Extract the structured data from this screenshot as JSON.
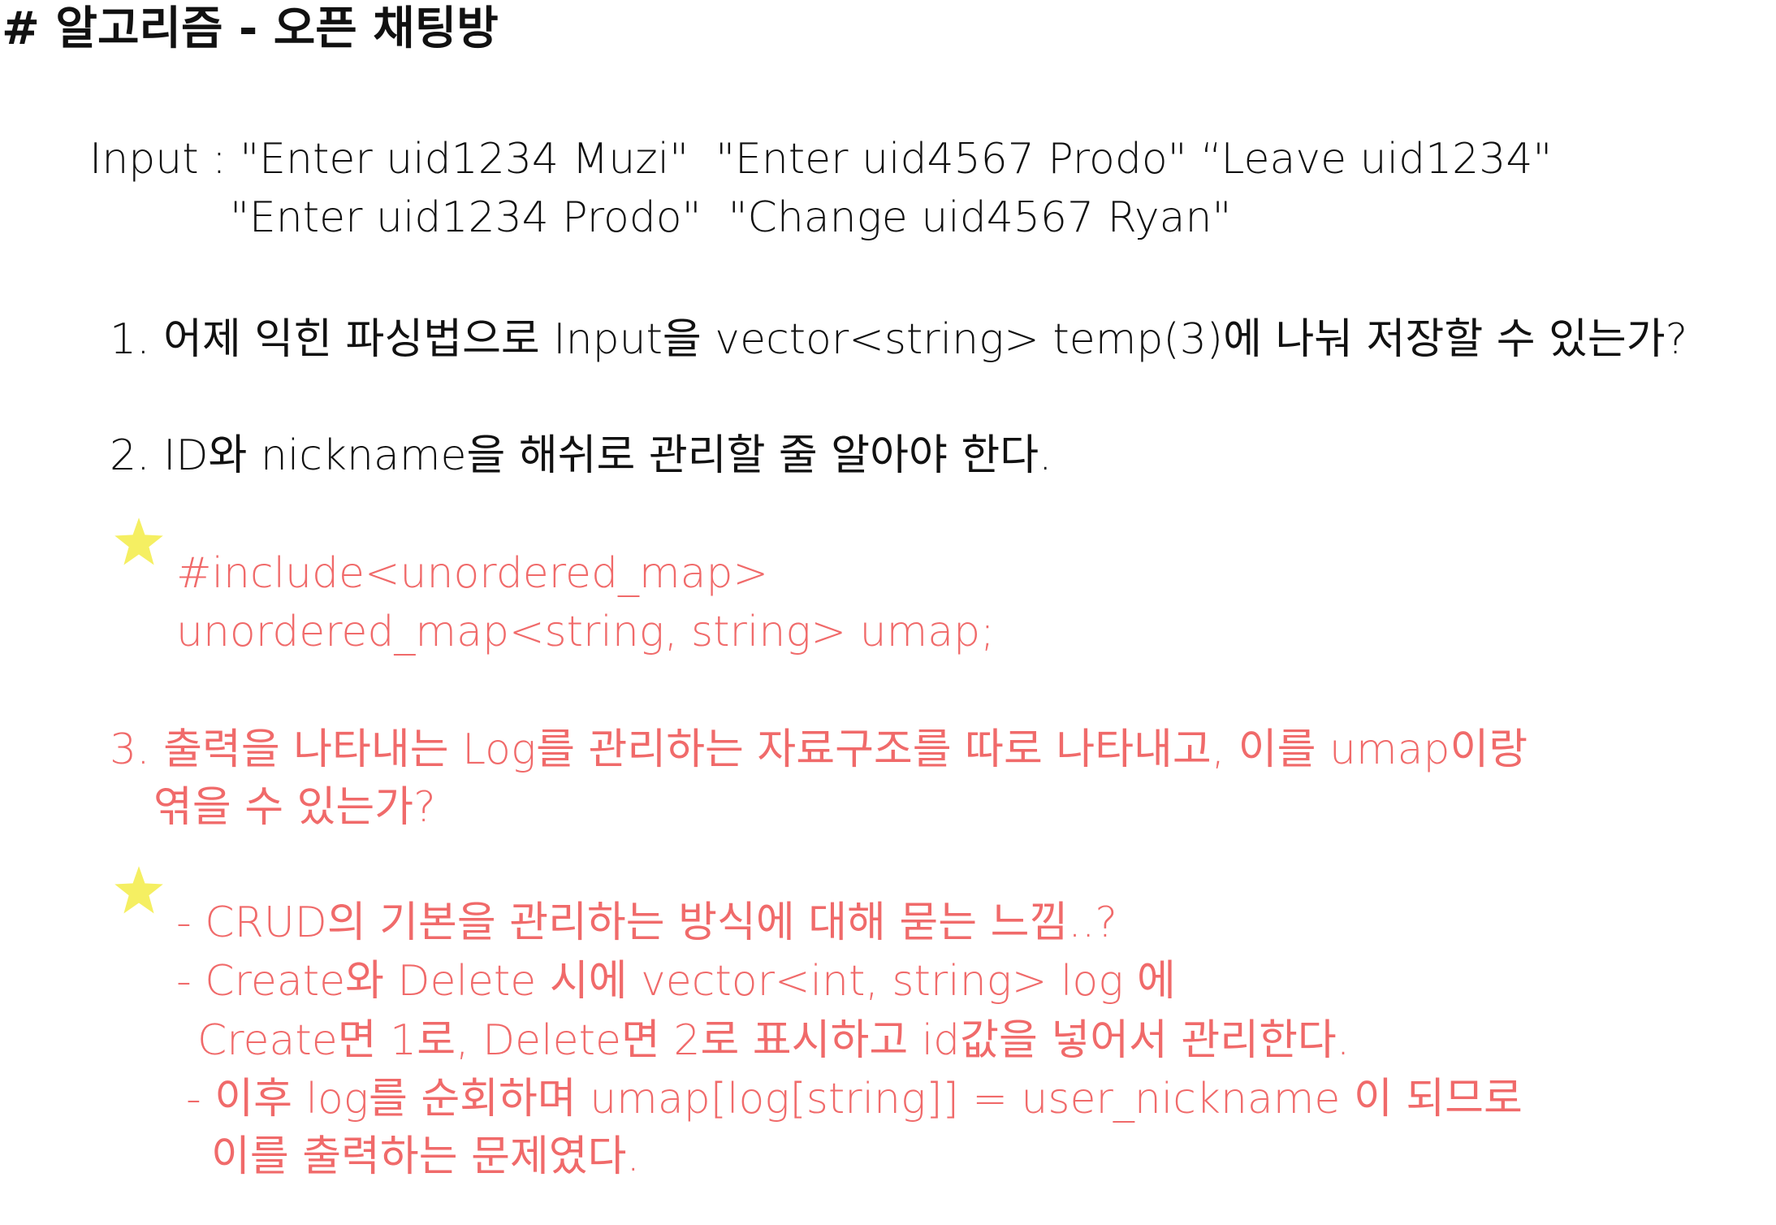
{
  "colors": {
    "text": "#111111",
    "accent": "#f06a6a",
    "star": "#f5ef62"
  },
  "title": "# 알고리즘 - 오픈 채팅방",
  "input": {
    "line1": "Input : \"Enter uid1234 Muzi\"  \"Enter uid4567 Prodo\" “Leave uid1234\"",
    "line2": "\"Enter uid1234 Prodo\"  \"Change uid4567 Ryan\""
  },
  "points": {
    "p1": "1. 어제 익힌 파싱법으로 Input을 vector<string> temp(3)에 나눠 저장할 수 있는가?",
    "p2": "2. ID와 nickname을 해쉬로 관리할 줄 알아야 한다.",
    "p3_line1": "3. 출력을 나타내는 Log를 관리하는 자료구조를 따로 나타내고, 이를 umap이랑",
    "p3_line2": "엮을 수 있는가?"
  },
  "code": {
    "line1": "#include<unordered_map>",
    "line2": "unordered_map<string, string> umap;"
  },
  "notes": {
    "line1": "- CRUD의 기본을 관리하는 방식에 대해 묻는 느낌..?",
    "line2": "- Create와 Delete 시에 vector<int, string> log 에",
    "line3": "Create면 1로, Delete면 2로 표시하고 id값을 넣어서 관리한다.",
    "line4": "- 이후 log를 순회하며 umap[log[string]] = user_nickname 이 되므로",
    "line5": "이를 출력하는 문제였다."
  },
  "icons": {
    "star1": "star-icon",
    "star2": "star-icon"
  }
}
